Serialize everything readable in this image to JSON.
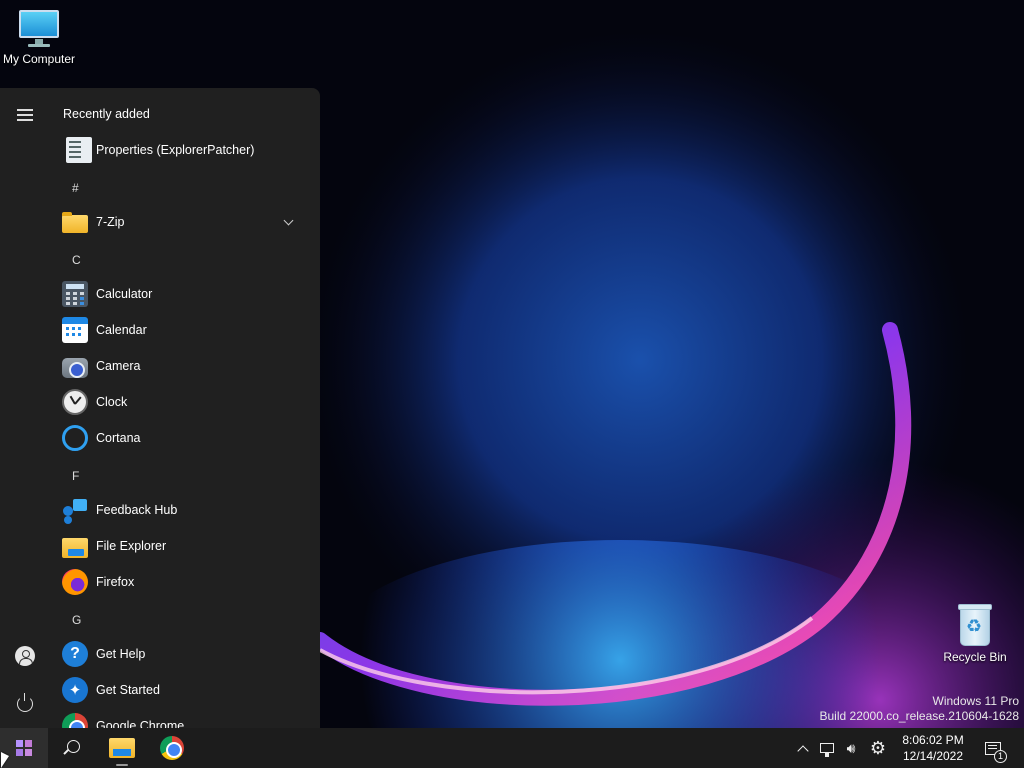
{
  "desktop": {
    "my_computer_label": "My Computer",
    "recycle_bin_label": "Recycle Bin",
    "watermark_line1": "Windows 11 Pro",
    "watermark_line2": "Build 22000.co_release.210604-1628"
  },
  "start_menu": {
    "section_title": "Recently added",
    "recent_apps": [
      {
        "label": "Properties (ExplorerPatcher)",
        "icon": "properties-icon"
      }
    ],
    "groups": [
      {
        "letter": "#",
        "apps": [
          {
            "label": "7-Zip",
            "icon": "folder-icon",
            "expandable": true
          }
        ]
      },
      {
        "letter": "C",
        "apps": [
          {
            "label": "Calculator",
            "icon": "calculator-icon"
          },
          {
            "label": "Calendar",
            "icon": "calendar-icon"
          },
          {
            "label": "Camera",
            "icon": "camera-icon"
          },
          {
            "label": "Clock",
            "icon": "clock-icon"
          },
          {
            "label": "Cortana",
            "icon": "cortana-icon"
          }
        ]
      },
      {
        "letter": "F",
        "apps": [
          {
            "label": "Feedback Hub",
            "icon": "feedback-hub-icon"
          },
          {
            "label": "File Explorer",
            "icon": "file-explorer-icon"
          },
          {
            "label": "Firefox",
            "icon": "firefox-icon"
          }
        ]
      },
      {
        "letter": "G",
        "apps": [
          {
            "label": "Get Help",
            "icon": "get-help-icon"
          },
          {
            "label": "Get Started",
            "icon": "get-started-icon"
          },
          {
            "label": "Google Chrome",
            "icon": "chrome-icon"
          }
        ]
      }
    ]
  },
  "taskbar": {
    "pinned": [
      "start-icon",
      "search-icon",
      "file-explorer-icon",
      "chrome-icon"
    ],
    "tray_icons": [
      "chevron-up-icon",
      "network-icon",
      "volume-icon",
      "settings-gear-icon",
      "notification-icon"
    ],
    "time": "8:06:02 PM",
    "date": "12/14/2022",
    "notification_count": "1"
  },
  "colors": {
    "start_bg": "#202020",
    "taskbar_bg": "#1c1c1c",
    "accent": "#1e88e5"
  }
}
